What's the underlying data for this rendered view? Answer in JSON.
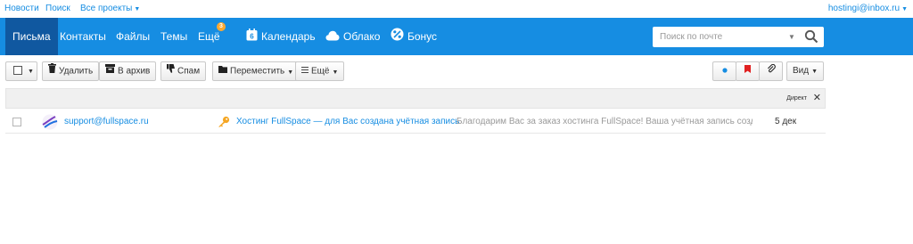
{
  "topbar": {
    "news": "Новости",
    "search": "Поиск",
    "projects": "Все проекты",
    "user": "hostingi@inbox.ru"
  },
  "nav": {
    "letters": "Письма",
    "contacts": "Контакты",
    "files": "Файлы",
    "themes": "Темы",
    "more": "Ещё",
    "more_badge": "3",
    "calendar": "Календарь",
    "calendar_day": "6",
    "cloud": "Облако",
    "bonus": "Бонус"
  },
  "search": {
    "placeholder": "Поиск по почте"
  },
  "toolbar": {
    "delete": "Удалить",
    "archive": "В архив",
    "spam": "Спам",
    "move": "Переместить",
    "more": "Ещё",
    "view": "Вид"
  },
  "list_header": {
    "direct": "Директ",
    "close": "✕"
  },
  "messages": [
    {
      "from": "support@fullspace.ru",
      "subject": "Хостинг FullSpace — для Вас создана учётная запись",
      "snippet": "Благодарим Вас за заказ хостинга FullSpace! Ваша учётная запись создана",
      "date": "5 дек"
    }
  ],
  "colors": {
    "brand": "#168de2",
    "active_nav": "#1058a0",
    "badge": "#ffa930",
    "flag": "#e02020",
    "key": "#f5a623"
  },
  "icons": [
    "trash-icon",
    "archive-icon",
    "thumbs-down-icon",
    "folder-icon",
    "menu-icon",
    "dot-icon",
    "flag-icon",
    "paperclip-icon",
    "search-icon",
    "calendar-icon",
    "cloud-icon",
    "bonus-icon",
    "key-icon",
    "avatar"
  ]
}
